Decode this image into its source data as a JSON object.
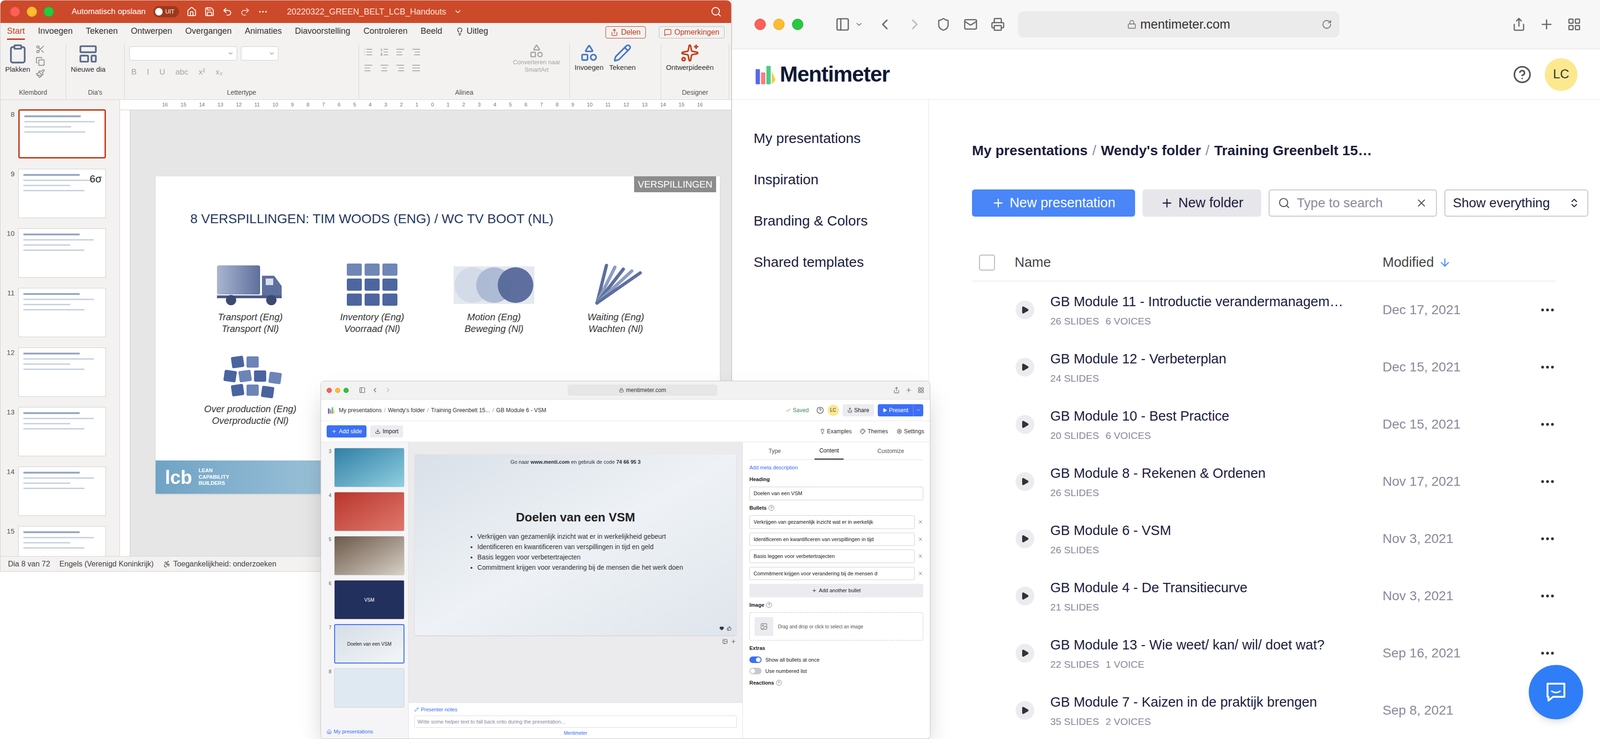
{
  "powerpoint": {
    "autosave": {
      "label": "Automatisch opslaan",
      "state": "UIT",
      "on": false
    },
    "title": "20220322_GREEN_BELT_LCB_Handouts",
    "tabs": [
      {
        "label": "Start",
        "selected": true
      },
      {
        "label": "Invoegen",
        "selected": false
      },
      {
        "label": "Tekenen",
        "selected": false
      },
      {
        "label": "Ontwerpen",
        "selected": false
      },
      {
        "label": "Overgangen",
        "selected": false
      },
      {
        "label": "Animaties",
        "selected": false
      },
      {
        "label": "Diavoorstelling",
        "selected": false
      },
      {
        "label": "Controleren",
        "selected": false
      },
      {
        "label": "Beeld",
        "selected": false
      }
    ],
    "tell_me": "Uitleg",
    "share": "Delen",
    "comments": "Opmerkingen",
    "ribbon": {
      "paste": "Plakken",
      "new_slide": "Nieuwe dia",
      "font_buttons": [
        {
          "label": "B",
          "disabled": true
        },
        {
          "label": "I",
          "disabled": true
        },
        {
          "label": "U",
          "disabled": true
        },
        {
          "label": "abc",
          "disabled": true
        },
        {
          "label": "x²",
          "disabled": true
        },
        {
          "label": "x₂",
          "disabled": true
        }
      ],
      "smartart": "Converteren naar SmartArt",
      "insert": "Invoegen",
      "draw": "Tekenen",
      "design_ideas": "Ontwerpideeën",
      "group_labels": {
        "clipboard": "Klembord",
        "slides": "Dia's",
        "font": "Lettertype",
        "paragraph": "Alinea",
        "designer": "Designer"
      }
    },
    "ruler_ticks": [
      "16",
      "15",
      "14",
      "13",
      "12",
      "11",
      "10",
      "9",
      "8",
      "7",
      "6",
      "5",
      "4",
      "3",
      "2",
      "1",
      "0",
      "1",
      "2",
      "3",
      "4",
      "5",
      "6",
      "7",
      "8",
      "9",
      "10",
      "11",
      "12",
      "13",
      "14",
      "15",
      "16"
    ],
    "thumbnails": [
      {
        "number": "8",
        "selected": true,
        "label": ""
      },
      {
        "number": "9",
        "selected": false,
        "label": "6σ"
      },
      {
        "number": "10",
        "selected": false,
        "label": ""
      },
      {
        "number": "11",
        "selected": false,
        "label": ""
      },
      {
        "number": "12",
        "selected": false,
        "label": ""
      },
      {
        "number": "13",
        "selected": false,
        "label": ""
      },
      {
        "number": "14",
        "selected": false,
        "label": ""
      },
      {
        "number": "15",
        "selected": false,
        "label": ""
      }
    ],
    "slide": {
      "tag": "VERSPILLINGEN",
      "title": "8 VERSPILLINGEN: TIM WOODS (ENG) / WC TV BOOT (NL)",
      "rows": [
        [
          {
            "kind": "truck",
            "eng": "Transport (Eng)",
            "nl": "Transport (Nl)"
          },
          {
            "kind": "grid",
            "eng": "Inventory (Eng)",
            "nl": "Voorraad (Nl)"
          },
          {
            "kind": "circles",
            "eng": "Motion (Eng)",
            "nl": "Beweging (Nl)"
          },
          {
            "kind": "rays",
            "eng": "Waiting (Eng)",
            "nl": "Wachten (Nl)"
          }
        ],
        [
          {
            "kind": "boxes",
            "eng": "Over production (Eng)",
            "nl": "Overproductie (Nl)"
          }
        ]
      ],
      "logo": "lcb",
      "logo_words": [
        "LEAN",
        "CAPABILITY",
        "BUILDERS"
      ]
    },
    "status": [
      "Dia 8 van 72",
      "Engels (Verenigd Koninkrijk)",
      "Toegankelijkheid: onderzoeken"
    ]
  },
  "browser": {
    "url": "mentimeter.com"
  },
  "mentimeter": {
    "logo": "Mentimeter",
    "avatar": "LC",
    "nav": [
      "My presentations",
      "Inspiration",
      "Branding & Colors",
      "Shared templates"
    ],
    "breadcrumb": [
      "My presentations",
      "Wendy's folder",
      "Training Greenbelt 15…"
    ],
    "separator": "/",
    "new_presentation": "New presentation",
    "new_folder": "New folder",
    "search_placeholder": "Type to search",
    "filter": "Show everything",
    "columns": {
      "name": "Name",
      "modified": "Modified"
    },
    "rows": [
      {
        "title": "GB Module 11 - Introductie verandermanagem…",
        "slides": "26 SLIDES",
        "voices": "6 VOICES",
        "modified": "Dec 17, 2021"
      },
      {
        "title": "GB Module 12 - Verbeterplan",
        "slides": "24 SLIDES",
        "voices": "",
        "modified": "Dec 15, 2021"
      },
      {
        "title": "GB Module 10 - Best Practice",
        "slides": "20 SLIDES",
        "voices": "6 VOICES",
        "modified": "Dec 15, 2021"
      },
      {
        "title": "GB Module 8 - Rekenen & Ordenen",
        "slides": "26 SLIDES",
        "voices": "",
        "modified": "Nov 17, 2021"
      },
      {
        "title": "GB Module 6 - VSM",
        "slides": "26 SLIDES",
        "voices": "",
        "modified": "Nov 3, 2021"
      },
      {
        "title": "GB Module 4 - De Transitiecurve",
        "slides": "21 SLIDES",
        "voices": "",
        "modified": "Nov 3, 2021"
      },
      {
        "title": "GB Module 13 - Wie weet/ kan/ wil/ doet wat?",
        "slides": "22 SLIDES",
        "voices": "1 VOICE",
        "modified": "Sep 16, 2021"
      },
      {
        "title": "GB Module 7 - Kaizen in de praktijk brengen",
        "slides": "35 SLIDES",
        "voices": "2 VOICES",
        "modified": "Sep 8, 2021"
      }
    ]
  },
  "editor": {
    "url": "mentimeter.com",
    "breadcrumb": [
      "My presentations",
      "Wendy's folder",
      "Training Greenbelt 15...",
      "GB Module 6 - VSM"
    ],
    "separator": "/",
    "saved": "Saved",
    "avatar": "LC",
    "share": "Share",
    "present": "Present",
    "add_slide": "Add slide",
    "import": "Import",
    "tools": [
      "Examples",
      "Themes",
      "Settings"
    ],
    "slides": [
      {
        "number": "3",
        "kind": "teal",
        "label": "",
        "selected": false
      },
      {
        "number": "4",
        "kind": "red",
        "label": "",
        "selected": false
      },
      {
        "number": "5",
        "kind": "photo",
        "label": "",
        "selected": false
      },
      {
        "number": "6",
        "kind": "dark",
        "label": "VSM",
        "selected": false
      },
      {
        "number": "7",
        "kind": "light",
        "label": "Doelen van een VSM",
        "selected": true
      },
      {
        "number": "8",
        "kind": "pale",
        "label": "",
        "selected": false
      }
    ],
    "back_link": "My presentations",
    "slide": {
      "code_prefix": "Go naar ",
      "site": "www.menti.com",
      "code_middle": " en gebruik de code ",
      "code": "74 66 95 3",
      "heading": "Doelen van een VSM",
      "bullets": [
        "Verkrijgen van gezamenlijk inzicht wat er in werkelijkheid gebeurt",
        "Identificeren en kwantificeren van verspillingen in tijd en geld",
        "Basis leggen voor verbetertrajecten",
        "Commitment krijgen voor verandering bij de mensen die het werk doen"
      ]
    },
    "notes_label": "Presenter notes",
    "notes_placeholder": "Write some helper text to fall back onto during the presentation...",
    "footer_link": "Mentimeter",
    "panel": {
      "tabs": [
        {
          "label": "Type",
          "selected": false
        },
        {
          "label": "Content",
          "selected": true
        },
        {
          "label": "Customize",
          "selected": false
        }
      ],
      "meta": "Add meta description",
      "heading_label": "Heading",
      "heading_value": "Doelen van een VSM",
      "bullets_label": "Bullets",
      "help": "?",
      "bullet_values": [
        "Verkrijgen van gezamenlijk inzicht wat er in werkelijk",
        "Identificeren en kwantificeren van verspillingen in tijd",
        "Basis leggen voor verbetertrajecten",
        "Commitment krijgen voor verandering bij de mensen d"
      ],
      "add_bullet": "Add another bullet",
      "image_label": "Image",
      "dropzone": "Drag and drop or click to select an image",
      "extras_label": "Extras",
      "toggles": [
        {
          "label": "Show all bullets at once",
          "on": true
        },
        {
          "label": "Use numbered list",
          "on": false
        }
      ],
      "reactions_label": "Reactions"
    }
  }
}
